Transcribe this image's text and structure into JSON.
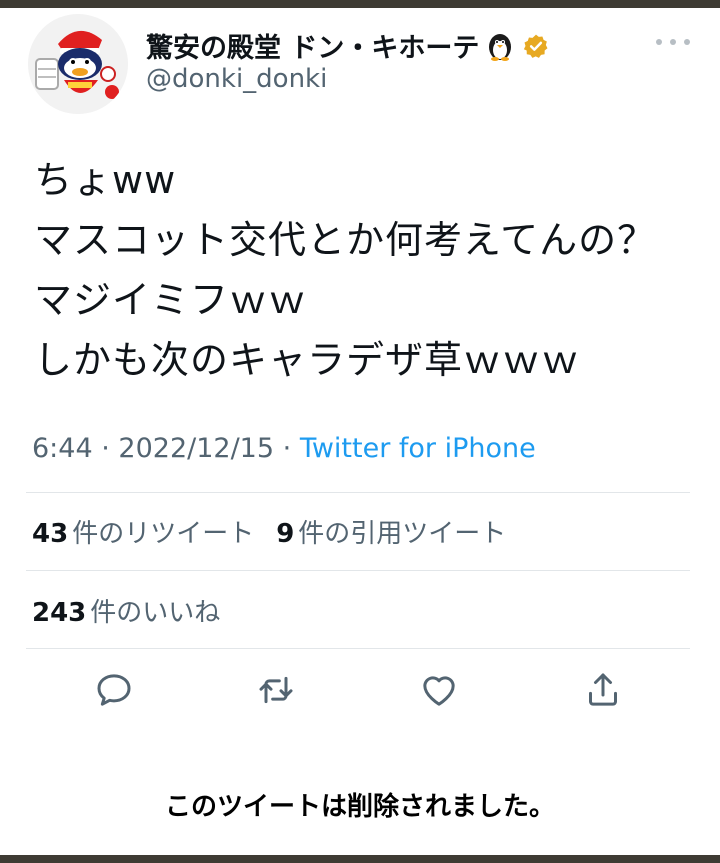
{
  "header": {
    "display_name": "驚安の殿堂 ドン・キホーテ",
    "handle": "@donki_donki",
    "verified_color": "#e7a922",
    "badges": [
      "penguin-emoji",
      "verified-badge"
    ]
  },
  "tweet": {
    "lines": [
      "ちょww",
      "マスコット交代とか何考えてんの？",
      "マジイミフｗｗ",
      "しかも次のキャラデザ草ｗｗｗ"
    ],
    "time": "6:44",
    "separator": "·",
    "date": "2022/12/15",
    "source": "Twitter for iPhone"
  },
  "stats": {
    "retweets_count": "43",
    "retweets_label": "件のリツイート",
    "quotes_count": "9",
    "quotes_label": "件の引用ツイート",
    "likes_count": "243",
    "likes_label": "件のいいね"
  },
  "actions": {
    "icons": [
      "reply-icon",
      "retweet-icon",
      "like-icon",
      "share-icon"
    ]
  },
  "footer_note": "このツイートは削除されました。",
  "colors": {
    "link": "#1d9bf0",
    "secondary_text": "#536471",
    "frame": "#3e3b33"
  }
}
